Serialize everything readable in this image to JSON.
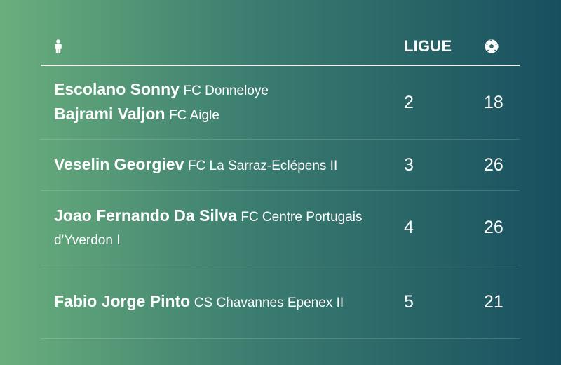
{
  "table": {
    "header": {
      "player_icon": "person-icon",
      "league_label": "LIGUE",
      "goals_icon": "soccer-ball-icon"
    },
    "rows": [
      {
        "players": [
          {
            "name": "Escolano Sonny",
            "club": "FC Donneloye"
          },
          {
            "name": "Bajrami Valjon",
            "club": "FC Aigle"
          }
        ],
        "league": "2",
        "goals": "18"
      },
      {
        "players": [
          {
            "name": "Veselin Georgiev",
            "club": "FC La Sarraz-Eclépens II"
          }
        ],
        "league": "3",
        "goals": "26"
      },
      {
        "players": [
          {
            "name": "Joao Fernando Da Silva",
            "club": "FC Centre Portugais d'Yverdon I"
          }
        ],
        "league": "4",
        "goals": "26"
      },
      {
        "players": [
          {
            "name": "Fabio Jorge Pinto",
            "club": "CS Chavannes Epenex II"
          }
        ],
        "league": "5",
        "goals": "21"
      }
    ]
  }
}
